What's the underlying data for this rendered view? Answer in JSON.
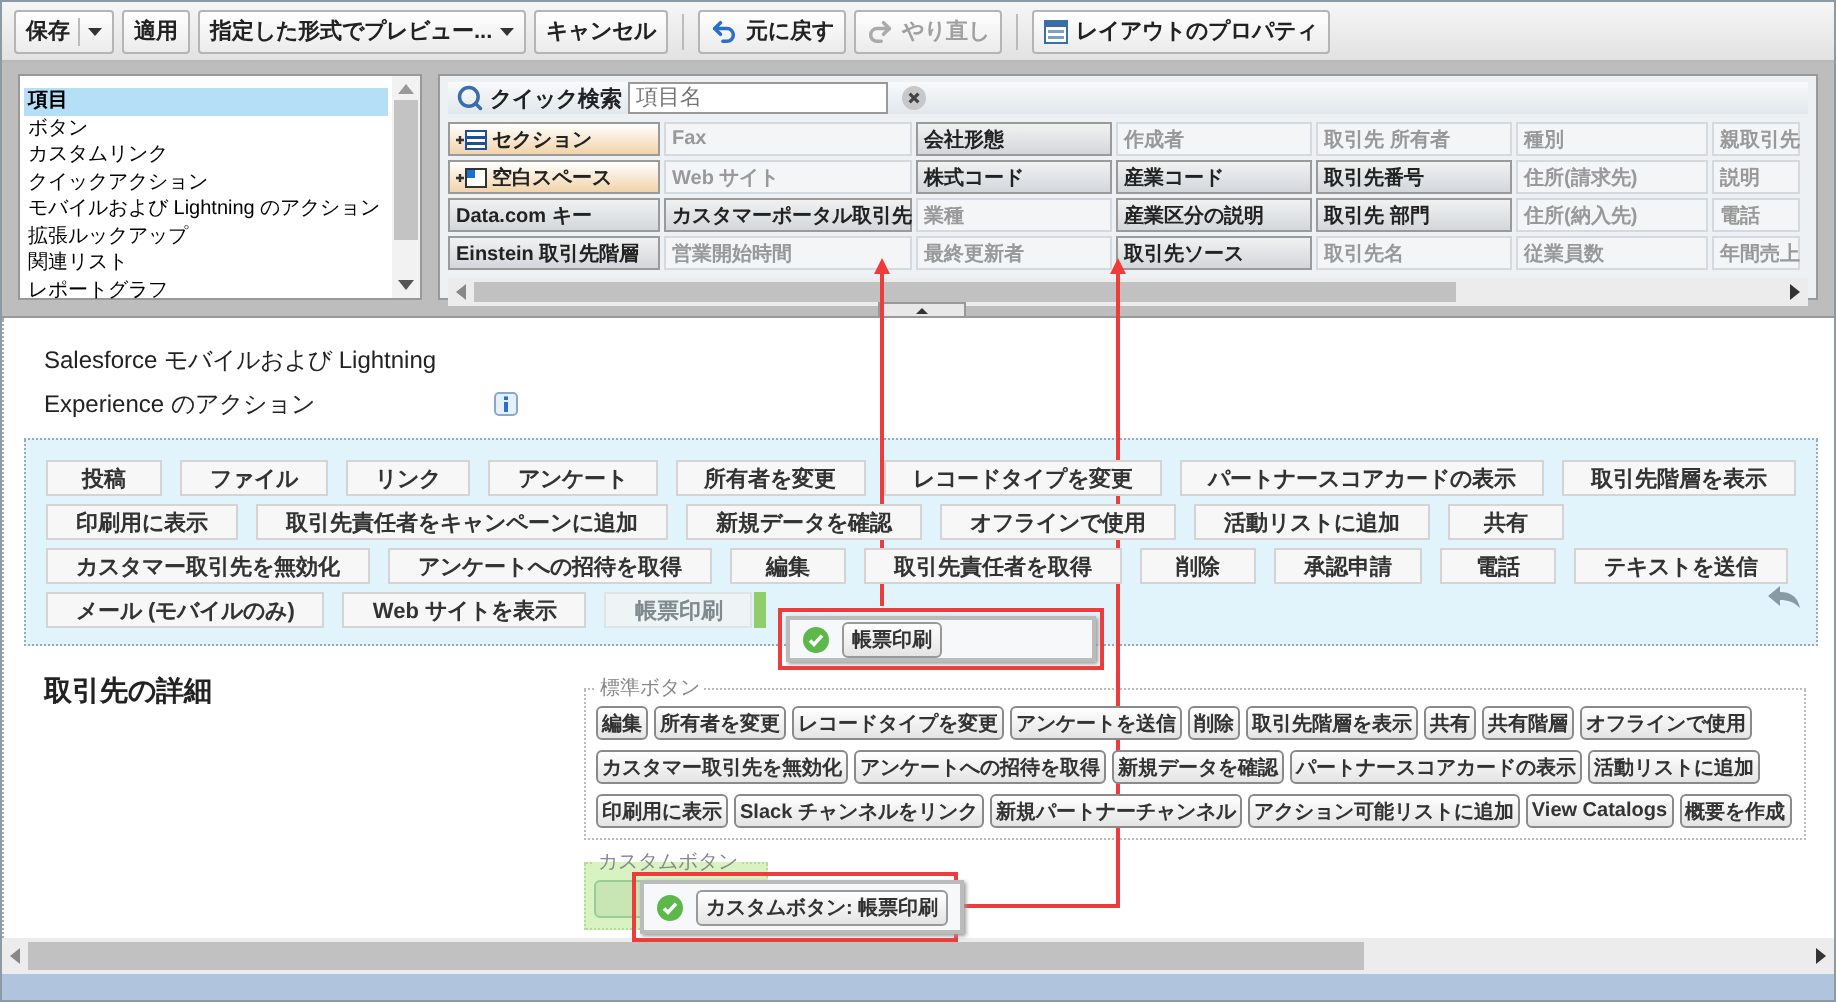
{
  "toolbar": {
    "groups": [
      {
        "buttons": [
          {
            "label": "保存",
            "kind": "split",
            "disabled": false
          },
          {
            "label": "適用",
            "kind": "plain",
            "disabled": false
          },
          {
            "label": "指定した形式でプレビュー...",
            "kind": "dropdown",
            "disabled": false
          },
          {
            "label": "キャンセル",
            "kind": "plain",
            "disabled": false
          }
        ]
      },
      {
        "buttons": [
          {
            "label": "元に戻す",
            "kind": "undo",
            "disabled": false
          },
          {
            "label": "やり直し",
            "kind": "redo",
            "disabled": true
          }
        ]
      },
      {
        "buttons": [
          {
            "label": "レイアウトのプロパティ",
            "kind": "properties",
            "disabled": false
          }
        ]
      }
    ]
  },
  "palette": {
    "categories": [
      {
        "label": "項目",
        "selected": true
      },
      {
        "label": "ボタン",
        "selected": false
      },
      {
        "label": "カスタムリンク",
        "selected": false
      },
      {
        "label": "クイックアクション",
        "selected": false
      },
      {
        "label": "モバイルおよび Lightning のアクション",
        "selected": false
      },
      {
        "label": "拡張ルックアップ",
        "selected": false
      },
      {
        "label": "関連リスト",
        "selected": false
      },
      {
        "label": "レポートグラフ",
        "selected": false
      }
    ],
    "search": {
      "label": "クイック検索",
      "placeholder": "項目名"
    },
    "rows": [
      {
        "cells": [
          {
            "label": "セクション",
            "kind": "section"
          },
          {
            "label": "Fax",
            "kind": "field",
            "used": true
          },
          {
            "label": "会社形態",
            "kind": "field",
            "used": false
          },
          {
            "label": "作成者",
            "kind": "field",
            "used": true
          },
          {
            "label": "取引先 所有者",
            "kind": "field",
            "used": true
          },
          {
            "label": "種別",
            "kind": "field",
            "used": true
          },
          {
            "label": "親取引先",
            "kind": "field",
            "used": true
          }
        ]
      },
      {
        "cells": [
          {
            "label": "空白スペース",
            "kind": "blank"
          },
          {
            "label": "Web サイト",
            "kind": "field",
            "used": true
          },
          {
            "label": "株式コード",
            "kind": "field",
            "used": false
          },
          {
            "label": "産業コード",
            "kind": "field",
            "used": false
          },
          {
            "label": "取引先番号",
            "kind": "field",
            "used": false
          },
          {
            "label": "住所(請求先)",
            "kind": "field",
            "used": true
          },
          {
            "label": "説明",
            "kind": "field",
            "used": true
          }
        ]
      },
      {
        "cells": [
          {
            "label": "Data.com キー",
            "kind": "field",
            "used": false
          },
          {
            "label": "カスタマーポータル取引先",
            "kind": "field",
            "used": false
          },
          {
            "label": "業種",
            "kind": "field",
            "used": true
          },
          {
            "label": "産業区分の説明",
            "kind": "field",
            "used": false
          },
          {
            "label": "取引先 部門",
            "kind": "field",
            "used": false
          },
          {
            "label": "住所(納入先)",
            "kind": "field",
            "used": true
          },
          {
            "label": "電話",
            "kind": "field",
            "used": true
          }
        ]
      },
      {
        "cells": [
          {
            "label": "Einstein 取引先階層",
            "kind": "field",
            "used": false
          },
          {
            "label": "営業開始時間",
            "kind": "field",
            "used": true
          },
          {
            "label": "最終更新者",
            "kind": "field",
            "used": true
          },
          {
            "label": "取引先ソース",
            "kind": "field",
            "used": false
          },
          {
            "label": "取引先名",
            "kind": "field",
            "used": true
          },
          {
            "label": "従業員数",
            "kind": "field",
            "used": true
          },
          {
            "label": "年間売上",
            "kind": "field",
            "used": true
          }
        ]
      }
    ]
  },
  "actions_section": {
    "title": "Salesforce モバイルおよび Lightning Experience のアクション",
    "rows": [
      {
        "buttons": [
          {
            "label": "投稿",
            "kind": "action"
          },
          {
            "label": "ファイル",
            "kind": "action"
          },
          {
            "label": "リンク",
            "kind": "action"
          },
          {
            "label": "アンケート",
            "kind": "action"
          },
          {
            "label": "所有者を変更",
            "kind": "action"
          },
          {
            "label": "レコードタイプを変更",
            "kind": "action"
          },
          {
            "label": "パートナースコアカードの表示",
            "kind": "action"
          },
          {
            "label": "取引先階層を表示",
            "kind": "action"
          }
        ]
      },
      {
        "buttons": [
          {
            "label": "印刷用に表示",
            "kind": "action"
          },
          {
            "label": "取引先責任者をキャンペーンに追加",
            "kind": "action"
          },
          {
            "label": "新規データを確認",
            "kind": "action"
          },
          {
            "label": "オフラインで使用",
            "kind": "action"
          },
          {
            "label": "活動リストに追加",
            "kind": "action"
          },
          {
            "label": "共有",
            "kind": "action"
          }
        ]
      },
      {
        "buttons": [
          {
            "label": "カスタマー取引先を無効化",
            "kind": "action"
          },
          {
            "label": "アンケートへの招待を取得",
            "kind": "action"
          },
          {
            "label": "編集",
            "kind": "action"
          },
          {
            "label": "取引先責任者を取得",
            "kind": "action"
          },
          {
            "label": "削除",
            "kind": "action"
          },
          {
            "label": "承認申請",
            "kind": "action"
          },
          {
            "label": "電話",
            "kind": "action"
          },
          {
            "label": "テキストを送信",
            "kind": "action"
          }
        ]
      },
      {
        "buttons": [
          {
            "label": "メール (モバイルのみ)",
            "kind": "action"
          },
          {
            "label": "Web サイトを表示",
            "kind": "action"
          },
          {
            "label": "帳票印刷",
            "kind": "placeholder"
          }
        ]
      }
    ]
  },
  "details_section": {
    "title": "取引先の詳細",
    "standard_buttons": {
      "legend": "標準ボタン",
      "rows": [
        {
          "buttons": [
            "編集",
            "所有者を変更",
            "レコードタイプを変更",
            "アンケートを送信",
            "削除",
            "取引先階層を表示",
            "共有",
            "共有階層",
            "オフラインで使用"
          ]
        },
        {
          "buttons": [
            "カスタマー取引先を無効化",
            "アンケートへの招待を取得",
            "新規データを確認",
            "パートナースコアカードの表示",
            "活動リストに追加"
          ]
        },
        {
          "buttons": [
            "印刷用に表示",
            "Slack チャンネルをリンク",
            "新規パートナーチャンネル",
            "アクション可能リストに追加",
            "View Catalogs",
            "概要を作成"
          ]
        }
      ]
    },
    "custom_buttons": {
      "legend": "カスタムボタン"
    }
  },
  "drag_previews": [
    {
      "label": "帳票印刷"
    },
    {
      "label": "カスタムボタン: 帳票印刷"
    }
  ]
}
